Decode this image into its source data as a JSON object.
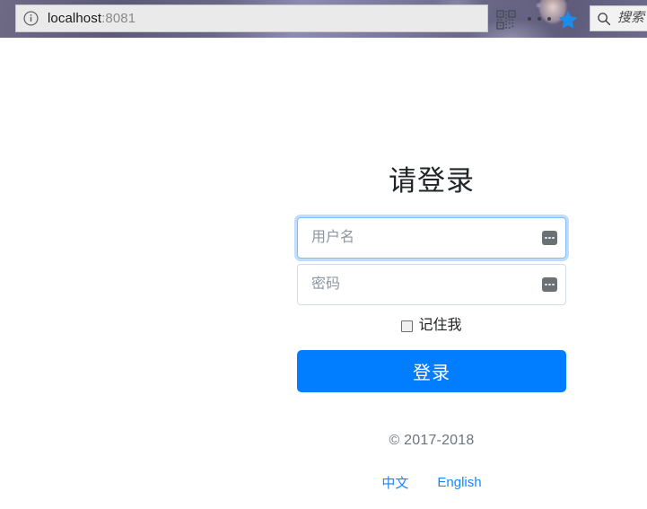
{
  "browser": {
    "security_icon": "info-circle-icon",
    "url_host": "localhost",
    "url_port": ":8081",
    "qr_icon": "qr-code-icon",
    "menu_icon": "more-horizontal-icon",
    "bookmark_icon": "star-icon",
    "search": {
      "icon": "search-magnifier-icon",
      "placeholder": "搜索",
      "value": ""
    }
  },
  "login": {
    "title": "请登录",
    "username": {
      "placeholder": "用户名",
      "value": "",
      "autofill_icon": "autofill-dots-icon"
    },
    "password": {
      "placeholder": "密码",
      "value": "",
      "autofill_icon": "autofill-dots-icon"
    },
    "remember": {
      "label": "记住我",
      "checked": false
    },
    "submit_label": "登录"
  },
  "footer": {
    "copyright": "© 2017-2018",
    "languages": [
      {
        "label": "中文"
      },
      {
        "label": "English"
      }
    ]
  },
  "colors": {
    "primary": "#007eff",
    "link": "#1a86ff",
    "focus_border": "#80bdff",
    "muted_text": "#6c757d"
  }
}
